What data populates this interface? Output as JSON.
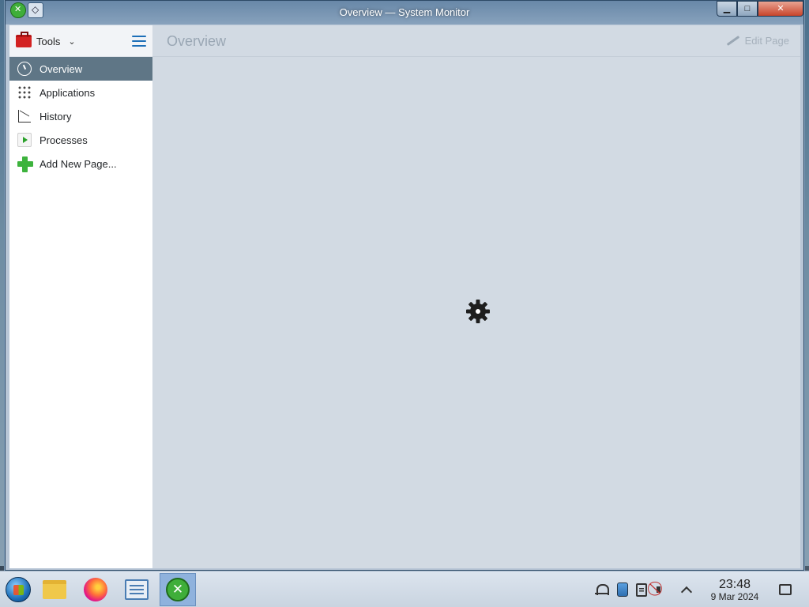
{
  "window": {
    "title": "Overview — System Monitor",
    "controls": {
      "minimize": "▁",
      "maximize": "□",
      "close": "✕"
    }
  },
  "sidebar": {
    "tools_label": "Tools",
    "items": [
      {
        "label": "Overview",
        "icon": "gauge-icon",
        "active": true
      },
      {
        "label": "Applications",
        "icon": "applications-grid-icon",
        "active": false
      },
      {
        "label": "History",
        "icon": "chart-line-icon",
        "active": false
      },
      {
        "label": "Processes",
        "icon": "processes-icon",
        "active": false
      },
      {
        "label": "Add New Page...",
        "icon": "add-icon",
        "active": false
      }
    ]
  },
  "main": {
    "page_title": "Overview",
    "edit_page_label": "Edit Page",
    "loading": true
  },
  "taskbar": {
    "pinned": [
      {
        "name": "start-menu",
        "icon": "start-orb-icon"
      },
      {
        "name": "file-manager",
        "icon": "folder-icon"
      },
      {
        "name": "firefox",
        "icon": "firefox-icon"
      },
      {
        "name": "system-settings",
        "icon": "system-settings-icon"
      },
      {
        "name": "system-monitor",
        "icon": "tools-icon",
        "active": true
      }
    ],
    "clock": {
      "time": "23:48",
      "date": "9 Mar 2024"
    }
  },
  "colors": {
    "sidebar_active": "#5f7686",
    "main_background": "#d2dae3",
    "accent": "#1d6fb8"
  }
}
